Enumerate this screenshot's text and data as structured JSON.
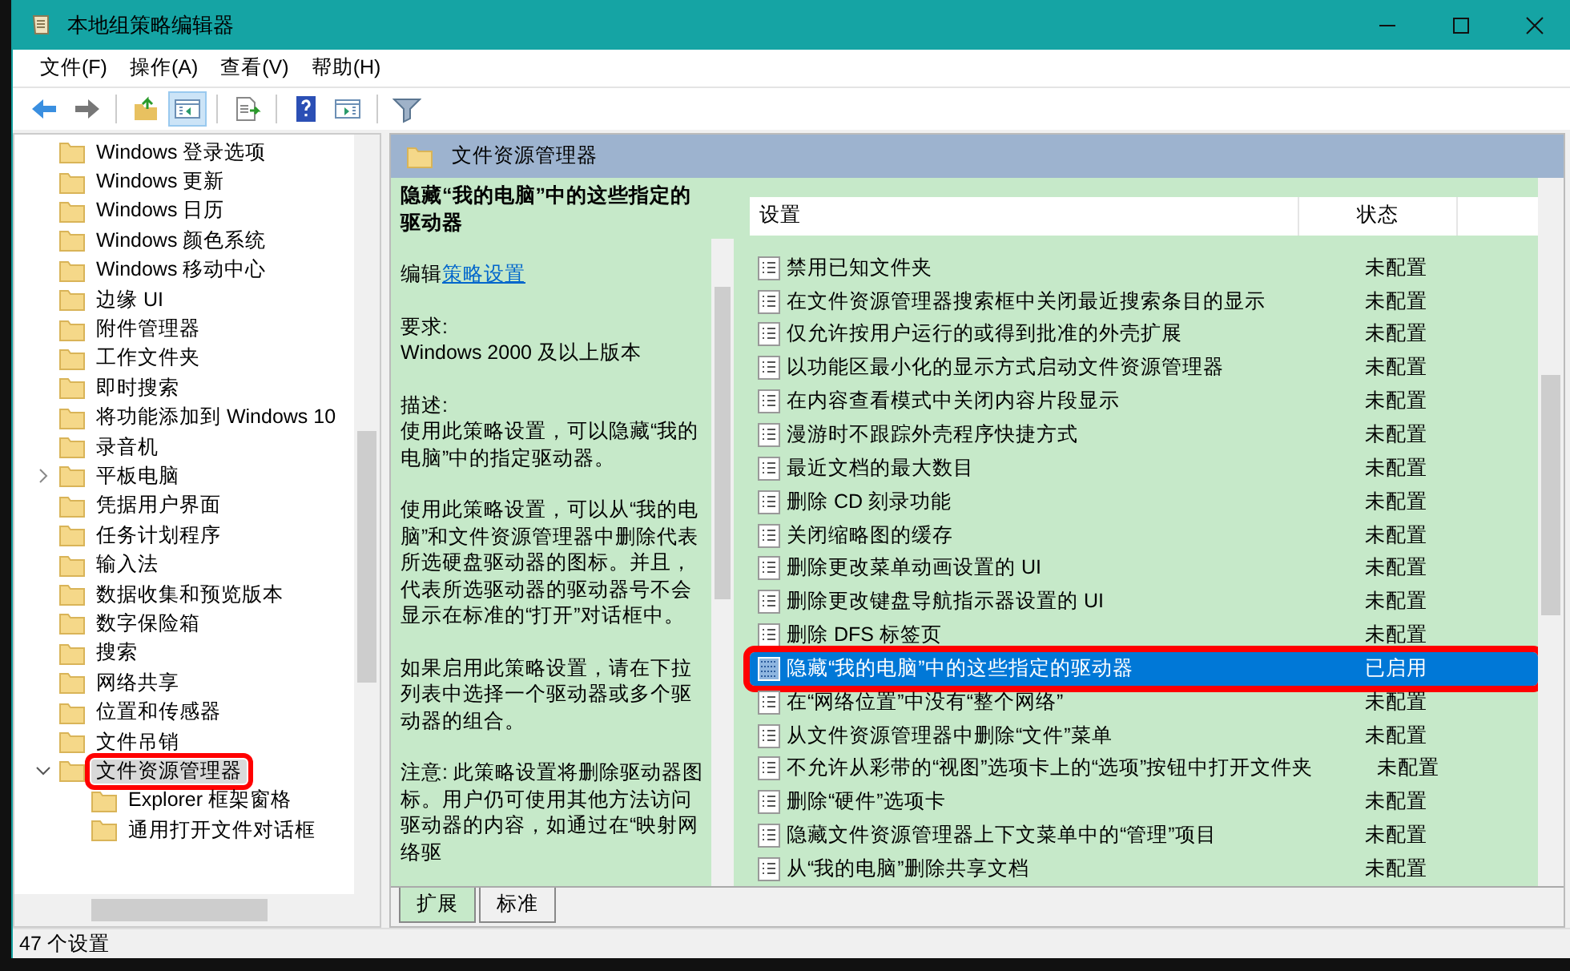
{
  "window": {
    "title": "本地组策略编辑器"
  },
  "menu": [
    "文件(F)",
    "操作(A)",
    "查看(V)",
    "帮助(H)"
  ],
  "toolbar": [
    {
      "kind": "back",
      "pressed": false
    },
    {
      "kind": "forward",
      "pressed": false
    },
    {
      "kind": "sep"
    },
    {
      "kind": "up",
      "pressed": false
    },
    {
      "kind": "tree",
      "pressed": true
    },
    {
      "kind": "sep"
    },
    {
      "kind": "export",
      "pressed": false
    },
    {
      "kind": "sep"
    },
    {
      "kind": "help",
      "pressed": false
    },
    {
      "kind": "pane",
      "pressed": false
    },
    {
      "kind": "sep"
    },
    {
      "kind": "filter",
      "pressed": false
    }
  ],
  "tree": [
    {
      "label": "Windows 登录选项",
      "selected": false,
      "highlighted": false
    },
    {
      "label": "Windows 更新",
      "selected": false,
      "highlighted": false
    },
    {
      "label": "Windows 日历",
      "selected": false,
      "highlighted": false
    },
    {
      "label": "Windows 颜色系统",
      "selected": false,
      "highlighted": false
    },
    {
      "label": "Windows 移动中心",
      "selected": false,
      "highlighted": false
    },
    {
      "label": "边缘 UI",
      "selected": false,
      "highlighted": false
    },
    {
      "label": "附件管理器",
      "selected": false,
      "highlighted": false
    },
    {
      "label": "工作文件夹",
      "selected": false,
      "highlighted": false
    },
    {
      "label": "即时搜索",
      "selected": false,
      "highlighted": false
    },
    {
      "label": "将功能添加到 Windows 10",
      "selected": false,
      "highlighted": false
    },
    {
      "label": "录音机",
      "selected": false,
      "highlighted": false
    },
    {
      "label": "平板电脑",
      "expanded": false,
      "selected": false,
      "highlighted": false
    },
    {
      "label": "凭据用户界面",
      "selected": false,
      "highlighted": false
    },
    {
      "label": "任务计划程序",
      "selected": false,
      "highlighted": false
    },
    {
      "label": "输入法",
      "selected": false,
      "highlighted": false
    },
    {
      "label": "数据收集和预览版本",
      "selected": false,
      "highlighted": false
    },
    {
      "label": "数字保险箱",
      "selected": false,
      "highlighted": false
    },
    {
      "label": "搜索",
      "selected": false,
      "highlighted": false
    },
    {
      "label": "网络共享",
      "selected": false,
      "highlighted": false
    },
    {
      "label": "位置和传感器",
      "selected": false,
      "highlighted": false
    },
    {
      "label": "文件吊销",
      "selected": false,
      "highlighted": false
    },
    {
      "label": "文件资源管理器",
      "expanded": true,
      "selected": true,
      "highlighted": true,
      "children": [
        {
          "label": "Explorer 框架窗格",
          "selected": false,
          "highlighted": false
        },
        {
          "label": "通用打开文件对话框",
          "selected": false,
          "highlighted": false
        }
      ]
    }
  ],
  "pane": {
    "title": "文件资源管理器",
    "description": {
      "title": "隐藏“我的电脑”中的这些指定的驱动器",
      "edit_prefix": "编辑",
      "edit_link": "策略设置",
      "requirements_label": "要求:",
      "requirements": "Windows 2000 及以上版本",
      "description_label": "描述:",
      "paragraphs": [
        "使用此策略设置，可以隐藏“我的电脑”中的指定驱动器。",
        "使用此策略设置，可以从“我的电脑”和文件资源管理器中删除代表所选硬盘驱动器的图标。并且，代表所选驱动器的驱动器号不会显示在标准的“打开”对话框中。",
        "如果启用此策略设置，请在下拉列表中选择一个驱动器或多个驱动器的组合。",
        "注意: 此策略设置将删除驱动器图标。用户仍可使用其他方法访问驱动器的内容，如通过在“映射网络驱"
      ]
    },
    "columns": [
      "设置",
      "状态"
    ],
    "rows": [
      {
        "name": "禁用已知文件夹",
        "state": "未配置",
        "selected": false,
        "highlighted": false
      },
      {
        "name": "在文件资源管理器搜索框中关闭最近搜索条目的显示",
        "state": "未配置",
        "selected": false,
        "highlighted": false
      },
      {
        "name": "仅允许按用户运行的或得到批准的外壳扩展",
        "state": "未配置",
        "selected": false,
        "highlighted": false
      },
      {
        "name": "以功能区最小化的显示方式启动文件资源管理器",
        "state": "未配置",
        "selected": false,
        "highlighted": false
      },
      {
        "name": "在内容查看模式中关闭内容片段显示",
        "state": "未配置",
        "selected": false,
        "highlighted": false
      },
      {
        "name": "漫游时不跟踪外壳程序快捷方式",
        "state": "未配置",
        "selected": false,
        "highlighted": false
      },
      {
        "name": "最近文档的最大数目",
        "state": "未配置",
        "selected": false,
        "highlighted": false
      },
      {
        "name": "删除 CD 刻录功能",
        "state": "未配置",
        "selected": false,
        "highlighted": false
      },
      {
        "name": "关闭缩略图的缓存",
        "state": "未配置",
        "selected": false,
        "highlighted": false
      },
      {
        "name": "删除更改菜单动画设置的 UI",
        "state": "未配置",
        "selected": false,
        "highlighted": false
      },
      {
        "name": "删除更改键盘导航指示器设置的 UI",
        "state": "未配置",
        "selected": false,
        "highlighted": false
      },
      {
        "name": "删除 DFS 标签页",
        "state": "未配置",
        "selected": false,
        "highlighted": false
      },
      {
        "name": "隐藏“我的电脑”中的这些指定的驱动器",
        "state": "已启用",
        "selected": true,
        "highlighted": true
      },
      {
        "name": "在“网络位置”中没有“整个网络”",
        "state": "未配置",
        "selected": false,
        "highlighted": false
      },
      {
        "name": "从文件资源管理器中删除“文件”菜单",
        "state": "未配置",
        "selected": false,
        "highlighted": false
      },
      {
        "name": "不允许从彩带的“视图”选项卡上的“选项”按钮中打开文件夹",
        "state": "未配置",
        "selected": false,
        "highlighted": false
      },
      {
        "name": "删除“硬件”选项卡",
        "state": "未配置",
        "selected": false,
        "highlighted": false
      },
      {
        "name": "隐藏文件资源管理器上下文菜单中的“管理”项目",
        "state": "未配置",
        "selected": false,
        "highlighted": false
      },
      {
        "name": "从“我的电脑”删除共享文档",
        "state": "未配置",
        "selected": false,
        "highlighted": false
      }
    ],
    "tabs": [
      {
        "label": "扩展",
        "selected": true
      },
      {
        "label": "标准",
        "selected": false
      }
    ]
  },
  "status_bar": "47 个设置"
}
